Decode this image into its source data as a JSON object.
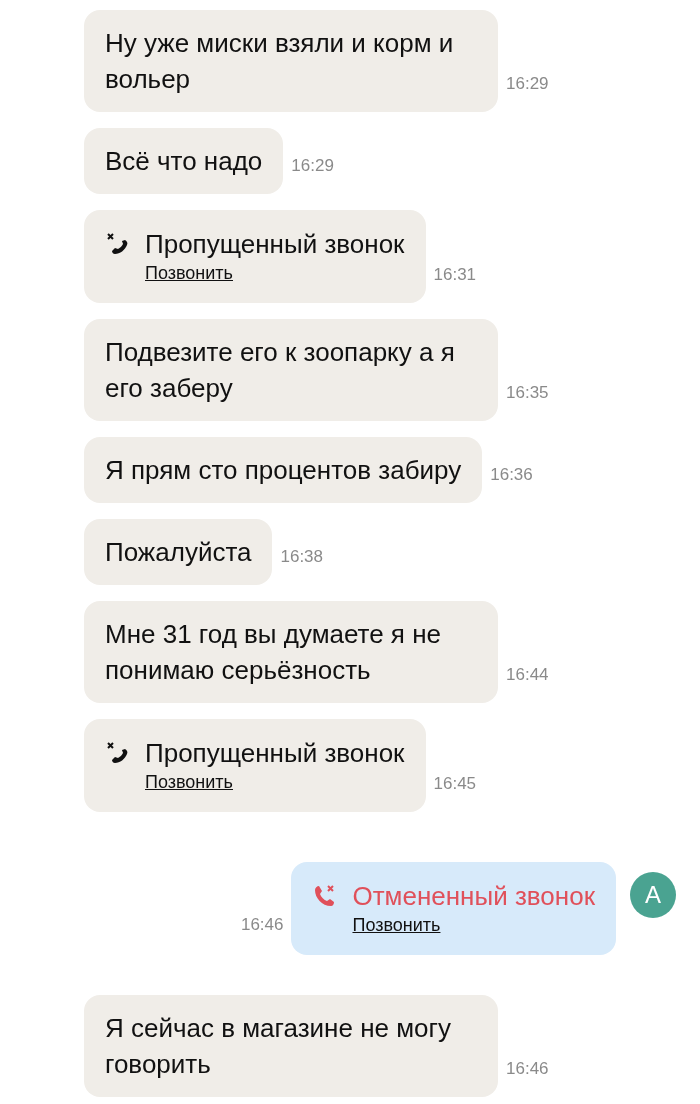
{
  "messages": [
    {
      "kind": "text",
      "outgoing": false,
      "text": "Ну уже миски взяли и корм и вольер",
      "time": "16:29"
    },
    {
      "kind": "text",
      "outgoing": false,
      "text": "Всё что надо",
      "time": "16:29"
    },
    {
      "kind": "missed_call",
      "outgoing": false,
      "title": "Пропущенный звонок",
      "action": "Позвонить",
      "time": "16:31"
    },
    {
      "kind": "text",
      "outgoing": false,
      "text": "Подвезите его к зоопарку а я его заберу",
      "time": "16:35"
    },
    {
      "kind": "text",
      "outgoing": false,
      "text": "Я прям сто процентов забиру",
      "time": "16:36"
    },
    {
      "kind": "text",
      "outgoing": false,
      "text": "Пожалуйста",
      "time": "16:38"
    },
    {
      "kind": "text",
      "outgoing": false,
      "text": "Мне 31 год вы думаете я не понимаю серьёзность",
      "time": "16:44"
    },
    {
      "kind": "missed_call",
      "outgoing": false,
      "title": "Пропущенный звонок",
      "action": "Позвонить",
      "time": "16:45"
    },
    {
      "kind": "cancelled_call",
      "outgoing": true,
      "title": "Отмененный звонок",
      "action": "Позвонить",
      "time": "16:46",
      "avatar": "А"
    },
    {
      "kind": "text",
      "outgoing": false,
      "text": "Я сейчас в магазине не могу говорить",
      "time": "16:46"
    }
  ]
}
